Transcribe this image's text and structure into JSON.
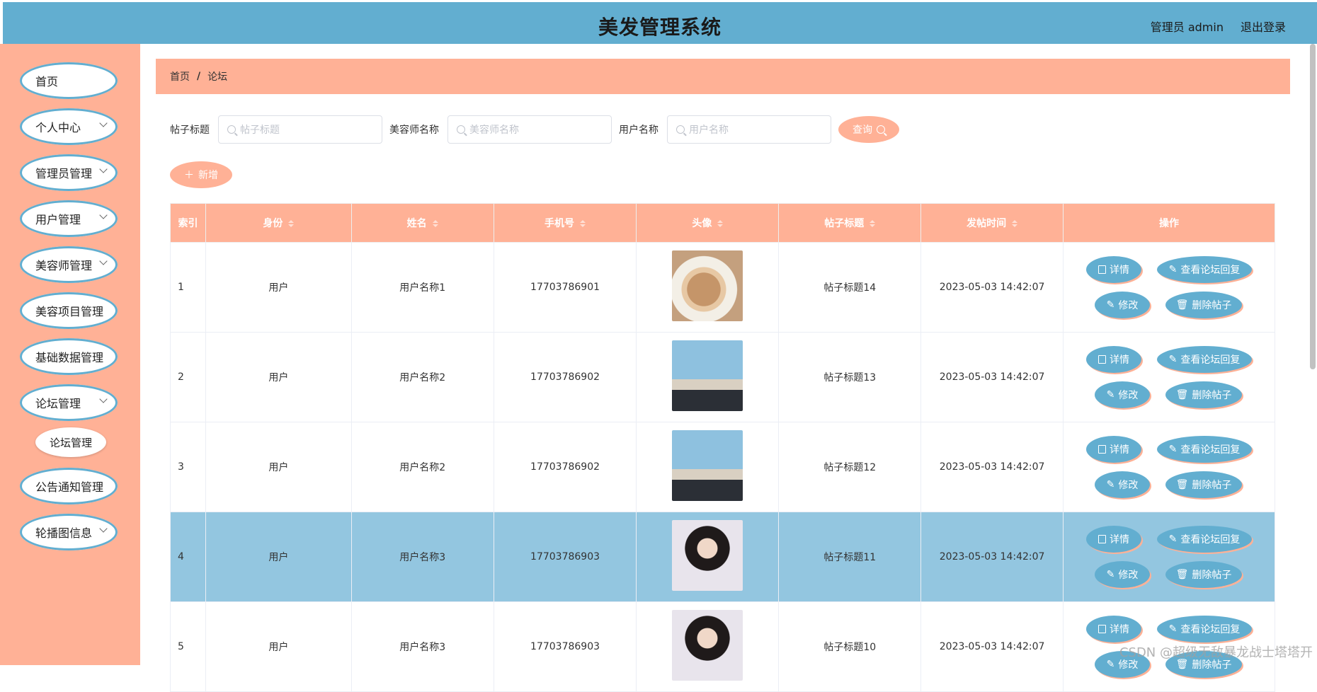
{
  "header": {
    "title": "美发管理系统",
    "user": "管理员 admin",
    "logout": "退出登录"
  },
  "sidebar": {
    "items": [
      {
        "label": "首页",
        "chevron": false
      },
      {
        "label": "个人中心",
        "chevron": true
      },
      {
        "label": "管理员管理",
        "chevron": true
      },
      {
        "label": "用户管理",
        "chevron": true
      },
      {
        "label": "美容师管理",
        "chevron": true
      },
      {
        "label": "美容项目管理",
        "chevron": false
      },
      {
        "label": "基础数据管理",
        "chevron": false
      },
      {
        "label": "论坛管理",
        "chevron": true
      },
      {
        "label": "公告通知管理",
        "chevron": false
      },
      {
        "label": "轮播图信息",
        "chevron": true
      }
    ],
    "sub_item": "论坛管理"
  },
  "breadcrumb": {
    "home": "首页",
    "sep": "/",
    "current": "论坛"
  },
  "search": {
    "title_label": "帖子标题",
    "title_placeholder": "帖子标题",
    "stylist_label": "美容师名称",
    "stylist_placeholder": "美容师名称",
    "user_label": "用户名称",
    "user_placeholder": "用户名称",
    "query_label": "查询"
  },
  "add_label": "新增",
  "table": {
    "headers": [
      "索引",
      "身份",
      "姓名",
      "手机号",
      "头像",
      "帖子标题",
      "发帖时间",
      "操作"
    ],
    "rows": [
      {
        "idx": "1",
        "role": "用户",
        "name": "用户名称1",
        "phone": "17703786901",
        "avatar": "cat-avatar",
        "title": "帖子标题14",
        "time": "2023-05-03 14:42:07"
      },
      {
        "idx": "2",
        "role": "用户",
        "name": "用户名称2",
        "phone": "17703786902",
        "avatar": "man-avatar",
        "title": "帖子标题13",
        "time": "2023-05-03 14:42:07"
      },
      {
        "idx": "3",
        "role": "用户",
        "name": "用户名称2",
        "phone": "17703786902",
        "avatar": "man-avatar",
        "title": "帖子标题12",
        "time": "2023-05-03 14:42:07"
      },
      {
        "idx": "4",
        "role": "用户",
        "name": "用户名称3",
        "phone": "17703786903",
        "avatar": "woman-avatar",
        "title": "帖子标题11",
        "time": "2023-05-03 14:42:07"
      },
      {
        "idx": "5",
        "role": "用户",
        "name": "用户名称3",
        "phone": "17703786903",
        "avatar": "woman-avatar",
        "title": "帖子标题10",
        "time": "2023-05-03 14:42:07"
      }
    ],
    "ops": {
      "detail": "详情",
      "reply": "查看论坛回复",
      "edit": "修改",
      "del": "删除帖子"
    }
  },
  "watermark": "CSDN @超级无敌暴龙战士塔塔开",
  "colors": {
    "header": "#62aed0",
    "accent": "#ffb196",
    "highlight_row": "#93c6e0"
  }
}
